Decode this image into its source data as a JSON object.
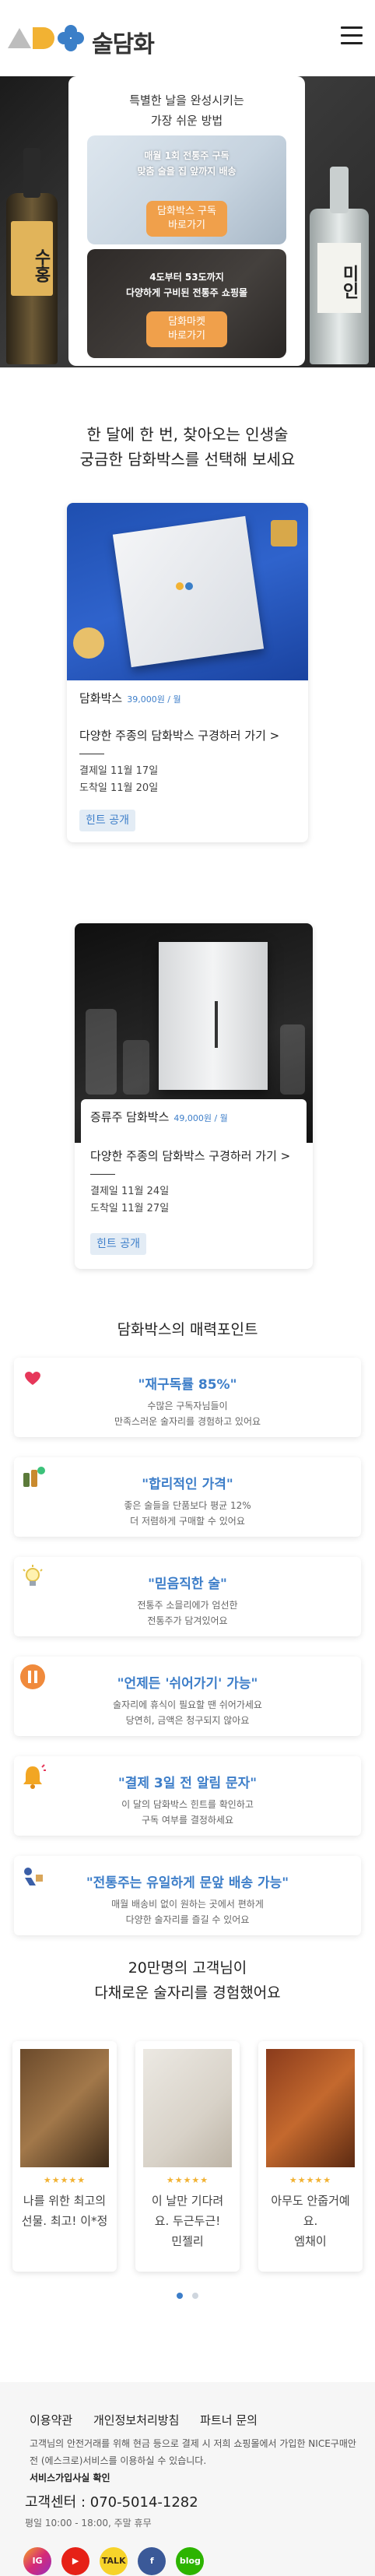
{
  "header": {
    "logo_text": "술담화"
  },
  "hero": {
    "title_line1": "특별한 날을 완성시키는",
    "title_line2": "가장 쉬운 방법",
    "promo1": {
      "line1": "매월 1회 전통주 구독",
      "line2": "맞춤 술을 집 앞까지 배송",
      "button": "담화박스 구독",
      "button2": "바로가기"
    },
    "promo2": {
      "line1": "4도부터 53도까지",
      "line2": "다양하게 구비된 전통주 쇼핑몰",
      "button": "담화마켓",
      "button2": "바로가기"
    },
    "bottle_left_label": "수홍",
    "bottle_right_label": "미인"
  },
  "section_subscribe": {
    "line1": "한 달에 한 번, 찾아오는 인생술",
    "line2": "궁금한 담화박스를 선택해 보세요"
  },
  "products": [
    {
      "name": "담화박스",
      "price": "39,000원 / 월",
      "link": "다양한 주종의 담화박스 구경하러 가기 >",
      "pay": "결제일 11월 17일",
      "arrive": "도착일 11월 20일",
      "hint": "힌트 공개"
    },
    {
      "name": "증류주 담화박스",
      "price": "49,000원 / 월",
      "link": "다양한 주종의 담화박스 구경하러 가기 >",
      "pay": "결제일 11월 24일",
      "arrive": "도착일 11월 27일",
      "hint": "힌트 공개"
    }
  ],
  "points_title": "담화박스의 매력포인트",
  "points": [
    {
      "title": "\"재구독률 85%\"",
      "desc1": "수많은 구독자님들이",
      "desc2": "만족스러운 술자리를 경험하고 있어요",
      "icon": "heart-icon"
    },
    {
      "title": "\"합리적인 가격\"",
      "desc1": "좋은 술들을 단품보다 평균 12%",
      "desc2": "더 저렴하게 구매할 수 있어요",
      "icon": "bottles-icon"
    },
    {
      "title": "\"믿음직한 술\"",
      "desc1": "전통주 소믈리에가 엄선한",
      "desc2": "전통주가 담겨있어요",
      "icon": "bulb-icon"
    },
    {
      "title": "\"언제든 '쉬어가기' 가능\"",
      "desc1": "술자리에 휴식이 필요할 땐 쉬어가세요",
      "desc2": "당연히, 금액은 청구되지 않아요",
      "icon": "pause-icon"
    },
    {
      "title": "\"결제 3일 전 알림 문자\"",
      "desc1": "이 달의 담화박스 힌트를 확인하고",
      "desc2": "구독 여부를 결정하세요",
      "icon": "bell-icon"
    },
    {
      "title": "\"전통주는 유일하게 문앞 배송 가능\"",
      "desc1": "매월 배송비 없이 원하는 곳에서 편하게",
      "desc2": "다양한 술자리를 즐길 수 있어요",
      "icon": "delivery-icon"
    }
  ],
  "reviews_title": {
    "line1": "20만명의 고객님이",
    "line2": "다채로운 술자리를 경험했어요"
  },
  "reviews": [
    {
      "stars": "★★★★★",
      "line1": "나를 위한 최고의",
      "line2": "선물. 최고! 이*정"
    },
    {
      "stars": "★★★★★",
      "line1": "이 날만 기다려",
      "line2": "요. 두근두근!",
      "line3": "민젤리"
    },
    {
      "stars": "★★★★★",
      "line1": "아무도 안줍거예",
      "line2": "요.",
      "line3": "엠채이"
    }
  ],
  "footer": {
    "links": [
      "이용약관",
      "개인정보처리방침",
      "파트너 문의"
    ],
    "desc": "고객님의 안전거래를 위해 현금 등으로 결제 시 저희 쇼핑몰에서 가입한 NICE구매안전 (에스크로)서비스를 이용하실 수 있습니다.",
    "desc_link": "서비스가입사실 확인",
    "center": "고객센터 : 070-5014-1282",
    "hours": "평일 10:00 - 18:00, 주말 휴무"
  },
  "colors": {
    "accent": "#3d7ec9",
    "orange": "#f0a04b",
    "yellow": "#f2b233"
  }
}
